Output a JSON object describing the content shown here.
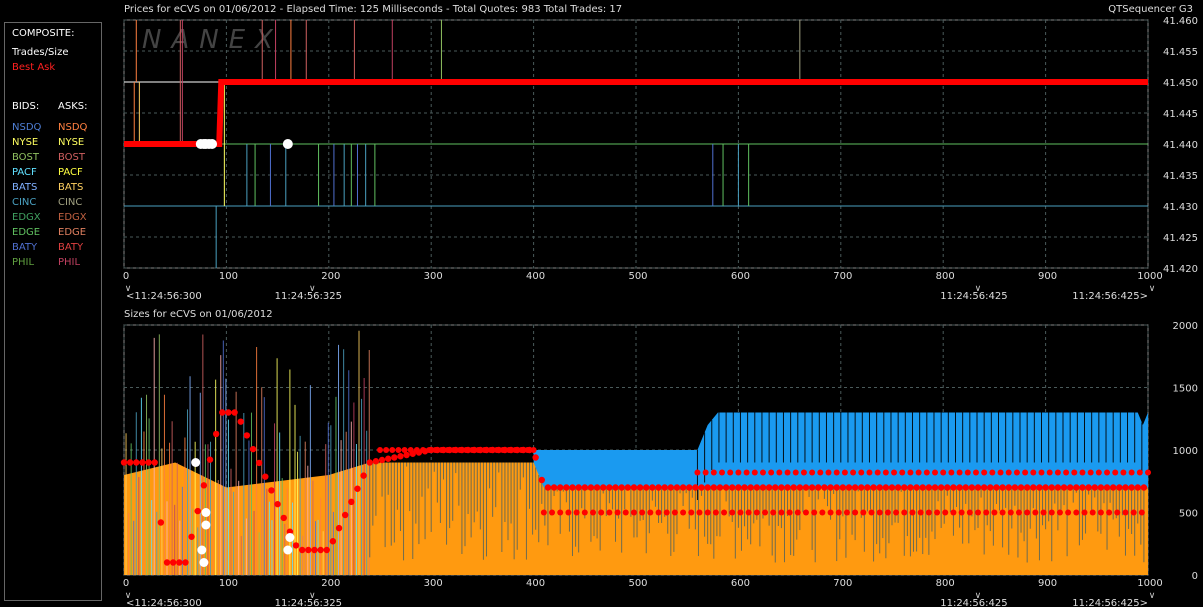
{
  "header": {
    "top_title": "Prices for  eCVS  on  01/06/2012  -  Elapsed Time: 125 Milliseconds  -  Total Quotes: 983  Total Trades: 17",
    "app_name": "QTSequencer G3",
    "bottom_title": "Sizes for  eCVS  on  01/06/2012",
    "watermark": "NANEX"
  },
  "legend": {
    "composite_label": "COMPOSITE:",
    "trades_label": "Trades/Size",
    "best_ask_label": "Best Ask",
    "bids_header": "BIDS:",
    "asks_header": "ASKS:",
    "exchanges": [
      {
        "name": "NSDQ",
        "bid_color": "#4f7fd6",
        "ask_color": "#ff8040"
      },
      {
        "name": "NYSE",
        "bid_color": "#ffff60",
        "ask_color": "#ffff60"
      },
      {
        "name": "BOST",
        "bid_color": "#90c060",
        "ask_color": "#d06060"
      },
      {
        "name": "PACF",
        "bid_color": "#60e0ff",
        "ask_color": "#ffff40"
      },
      {
        "name": "BATS",
        "bid_color": "#80b0ff",
        "ask_color": "#ffd060"
      },
      {
        "name": "CINC",
        "bid_color": "#4aa0c0",
        "ask_color": "#a0a080"
      },
      {
        "name": "EDGX",
        "bid_color": "#40a060",
        "ask_color": "#c06040"
      },
      {
        "name": "EDGE",
        "bid_color": "#60c060",
        "ask_color": "#e08060"
      },
      {
        "name": "BATY",
        "bid_color": "#5070d0",
        "ask_color": "#e04040"
      },
      {
        "name": "PHIL",
        "bid_color": "#60a040",
        "ask_color": "#c04060"
      }
    ]
  },
  "colors": {
    "background": "#000000",
    "grid": "#4a5a5a",
    "best_ask": "#ff0000",
    "trade": "#ffffff",
    "bid_size_fill": "#1a9af0",
    "ask_size_fill": "#ff9a10"
  },
  "chart_data": [
    {
      "type": "line",
      "title": "Prices for  eCVS  on  01/06/2012",
      "xlim": [
        0,
        1000
      ],
      "ylim": [
        41.42,
        41.46
      ],
      "x_ticks": [
        0,
        100,
        200,
        300,
        400,
        500,
        600,
        700,
        800,
        900,
        1000
      ],
      "y_ticks": [
        "41.420",
        "41.425",
        "41.430",
        "41.435",
        "41.440",
        "41.445",
        "41.450",
        "41.455",
        "41.460"
      ],
      "time_labels": [
        {
          "x": 0,
          "text": "<11:24:56:300"
        },
        {
          "x": 180,
          "text": "11:24:56:325"
        },
        {
          "x": 830,
          "text": "11:24:56:425"
        },
        {
          "x": 1000,
          "text": "11:24:56:425>"
        }
      ],
      "series": [
        {
          "name": "Best Ask",
          "color": "#ff0000",
          "points": [
            [
              0,
              41.44
            ],
            [
              93,
              41.44
            ],
            [
              95,
              41.45
            ],
            [
              1000,
              41.45
            ]
          ]
        },
        {
          "name": "Trades/Size",
          "color": "#ffffff",
          "points": [
            [
              75,
              41.44
            ],
            [
              78,
              41.44
            ],
            [
              80,
              41.44
            ],
            [
              83,
              41.44
            ],
            [
              86,
              41.44
            ],
            [
              160,
              41.44
            ]
          ]
        }
      ],
      "quote_levels": [
        {
          "price": 41.45,
          "x_start": 0,
          "x_end": 95,
          "color": "#ffffff"
        },
        {
          "price": 41.44,
          "x_start": 95,
          "x_end": 1000,
          "color": "#60c060"
        },
        {
          "price": 41.43,
          "x_start": 0,
          "x_end": 1000,
          "color": "#4aa0c0"
        }
      ]
    },
    {
      "type": "area",
      "title": "Sizes for  eCVS  on  01/06/2012",
      "xlim": [
        0,
        1000
      ],
      "ylim": [
        0,
        2000
      ],
      "x_ticks": [
        0,
        100,
        200,
        300,
        400,
        500,
        600,
        700,
        800,
        900,
        1000
      ],
      "y_ticks": [
        0,
        500,
        1000,
        1500,
        2000
      ],
      "time_labels": [
        {
          "x": 0,
          "text": "<11:24:56:300"
        },
        {
          "x": 180,
          "text": "11:24:56:325"
        },
        {
          "x": 830,
          "text": "11:24:56:425"
        },
        {
          "x": 1000,
          "text": "11:24:56:425>"
        }
      ],
      "series": [
        {
          "name": "Bid size",
          "color": "#1a9af0",
          "points": [
            [
              400,
              1000
            ],
            [
              560,
              1000
            ],
            [
              570,
              1200
            ],
            [
              580,
              1300
            ],
            [
              990,
              1300
            ],
            [
              995,
              1200
            ],
            [
              1000,
              1300
            ]
          ]
        },
        {
          "name": "Ask size",
          "color": "#ff9a10",
          "points": [
            [
              0,
              800
            ],
            [
              50,
              900
            ],
            [
              100,
              700
            ],
            [
              200,
              800
            ],
            [
              240,
              900
            ],
            [
              300,
              900
            ],
            [
              400,
              900
            ],
            [
              410,
              700
            ],
            [
              1000,
              700
            ]
          ]
        },
        {
          "name": "Best Ask size",
          "color": "#ff0000",
          "points": [
            [
              0,
              900
            ],
            [
              30,
              900
            ],
            [
              40,
              100
            ],
            [
              60,
              100
            ],
            [
              95,
              1300
            ],
            [
              110,
              1300
            ],
            [
              170,
              200
            ],
            [
              200,
              200
            ],
            [
              240,
              900
            ],
            [
              300,
              1000
            ],
            [
              400,
              1000
            ],
            [
              410,
              700
            ],
            [
              1000,
              700
            ]
          ]
        }
      ]
    }
  ]
}
